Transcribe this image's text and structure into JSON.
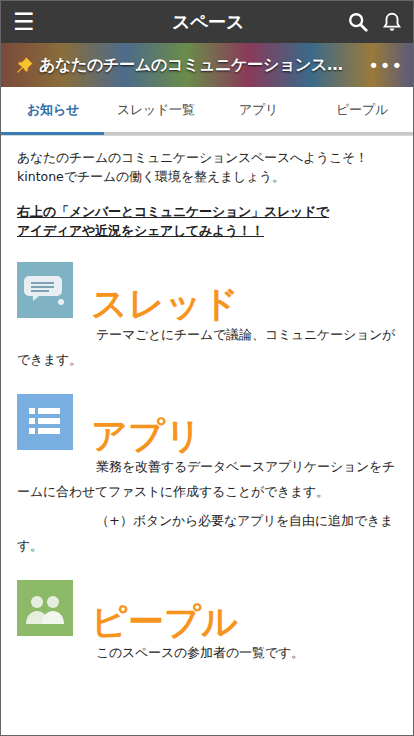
{
  "header": {
    "menu": "☰",
    "title": "スペース"
  },
  "space": {
    "pinned": true,
    "title": "あなたのチームのコミュニケーションス…",
    "more": "•••"
  },
  "tabs": [
    {
      "label": "お知らせ",
      "selected": true
    },
    {
      "label": "スレッド一覧",
      "selected": false
    },
    {
      "label": "アプリ",
      "selected": false
    },
    {
      "label": "ピープル",
      "selected": false
    }
  ],
  "notice": {
    "intro": [
      "あなたのチームのコミュニケーションスペースへようこそ！",
      "kintoneでチームの働く環境を整えましょう。"
    ],
    "highlight": [
      "右上の「メンバーとコミュニケーション」スレッドで",
      "アイディアや近況をシェアしてみよう！！"
    ]
  },
  "sections": [
    {
      "kind": "thread",
      "title": "スレッド",
      "color": "#7fb3c4",
      "paragraphs": [
        "テーマごとにチームで議論、コミュニケーションができます。"
      ]
    },
    {
      "kind": "app",
      "title": "アプリ",
      "color": "#78afe0",
      "paragraphs": [
        "業務を改善するデータベースアプリケーションをチームに合わせてファストに作成することができます。",
        "（+）ボタンから必要なアプリを自由に追加できます。"
      ]
    },
    {
      "kind": "people",
      "title": "ピープル",
      "color": "#8cba68",
      "paragraphs": [
        "このスペースの参加者の一覧です。"
      ]
    }
  ]
}
